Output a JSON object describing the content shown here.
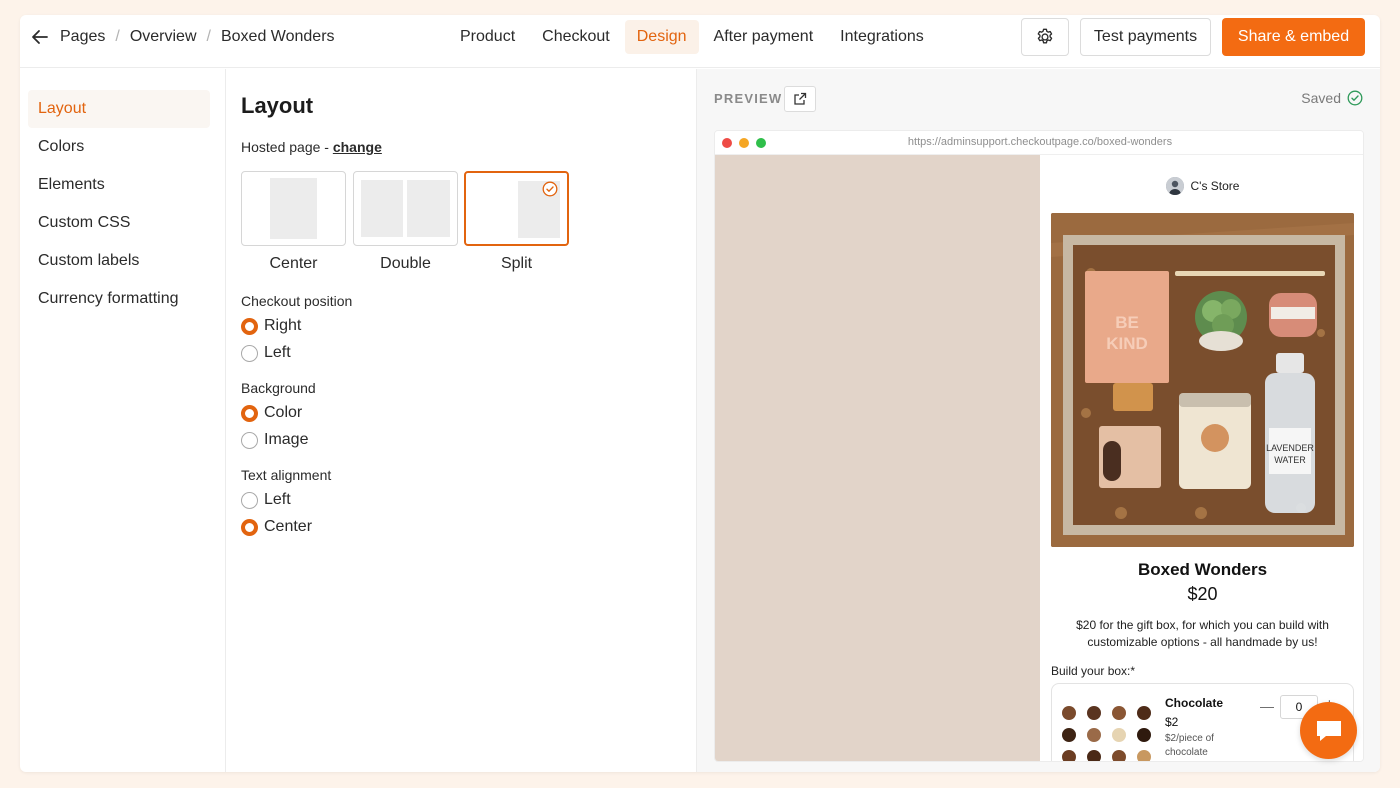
{
  "breadcrumb": {
    "items": [
      "Pages",
      "Overview",
      "Boxed Wonders"
    ],
    "sep": "/"
  },
  "tabs": [
    {
      "label": "Product",
      "active": false
    },
    {
      "label": "Checkout",
      "active": false
    },
    {
      "label": "Design",
      "active": true
    },
    {
      "label": "After payment",
      "active": false
    },
    {
      "label": "Integrations",
      "active": false
    }
  ],
  "actions": {
    "test_label": "Test payments",
    "share_label": "Share & embed"
  },
  "sidebar": {
    "items": [
      {
        "label": "Layout",
        "active": true
      },
      {
        "label": "Colors"
      },
      {
        "label": "Elements"
      },
      {
        "label": "Custom CSS"
      },
      {
        "label": "Custom labels"
      },
      {
        "label": "Currency formatting"
      }
    ]
  },
  "layout": {
    "title": "Layout",
    "hosted_prefix": "Hosted page - ",
    "hosted_link": "change",
    "options": [
      {
        "label": "Center",
        "selected": false
      },
      {
        "label": "Double",
        "selected": false
      },
      {
        "label": "Split",
        "selected": true
      }
    ],
    "checkout_position": {
      "label": "Checkout position",
      "options": [
        "Right",
        "Left"
      ],
      "selected": "Right"
    },
    "background": {
      "label": "Background",
      "options": [
        "Color",
        "Image"
      ],
      "selected": "Color"
    },
    "text_alignment": {
      "label": "Text alignment",
      "options": [
        "Left",
        "Center"
      ],
      "selected": "Center"
    }
  },
  "preview": {
    "label": "PREVIEW",
    "status": "Saved",
    "url": "https://adminsupport.checkoutpage.co/boxed-wonders",
    "left_color": "#e2d4c9",
    "store_name": "C's Store",
    "product": {
      "title": "Boxed Wonders",
      "price": "$20",
      "description": "$20 for the gift box, for which you can build with customizable options - all handmade by us!",
      "build_label": "Build your box:",
      "required_mark": "*",
      "option": {
        "name": "Chocolate",
        "price": "$2",
        "unit": "$2/piece of chocolate",
        "quantity": "0",
        "minus": "—",
        "plus": "+"
      }
    }
  },
  "colors": {
    "accent": "#e2640f",
    "button": "#f36b12"
  }
}
